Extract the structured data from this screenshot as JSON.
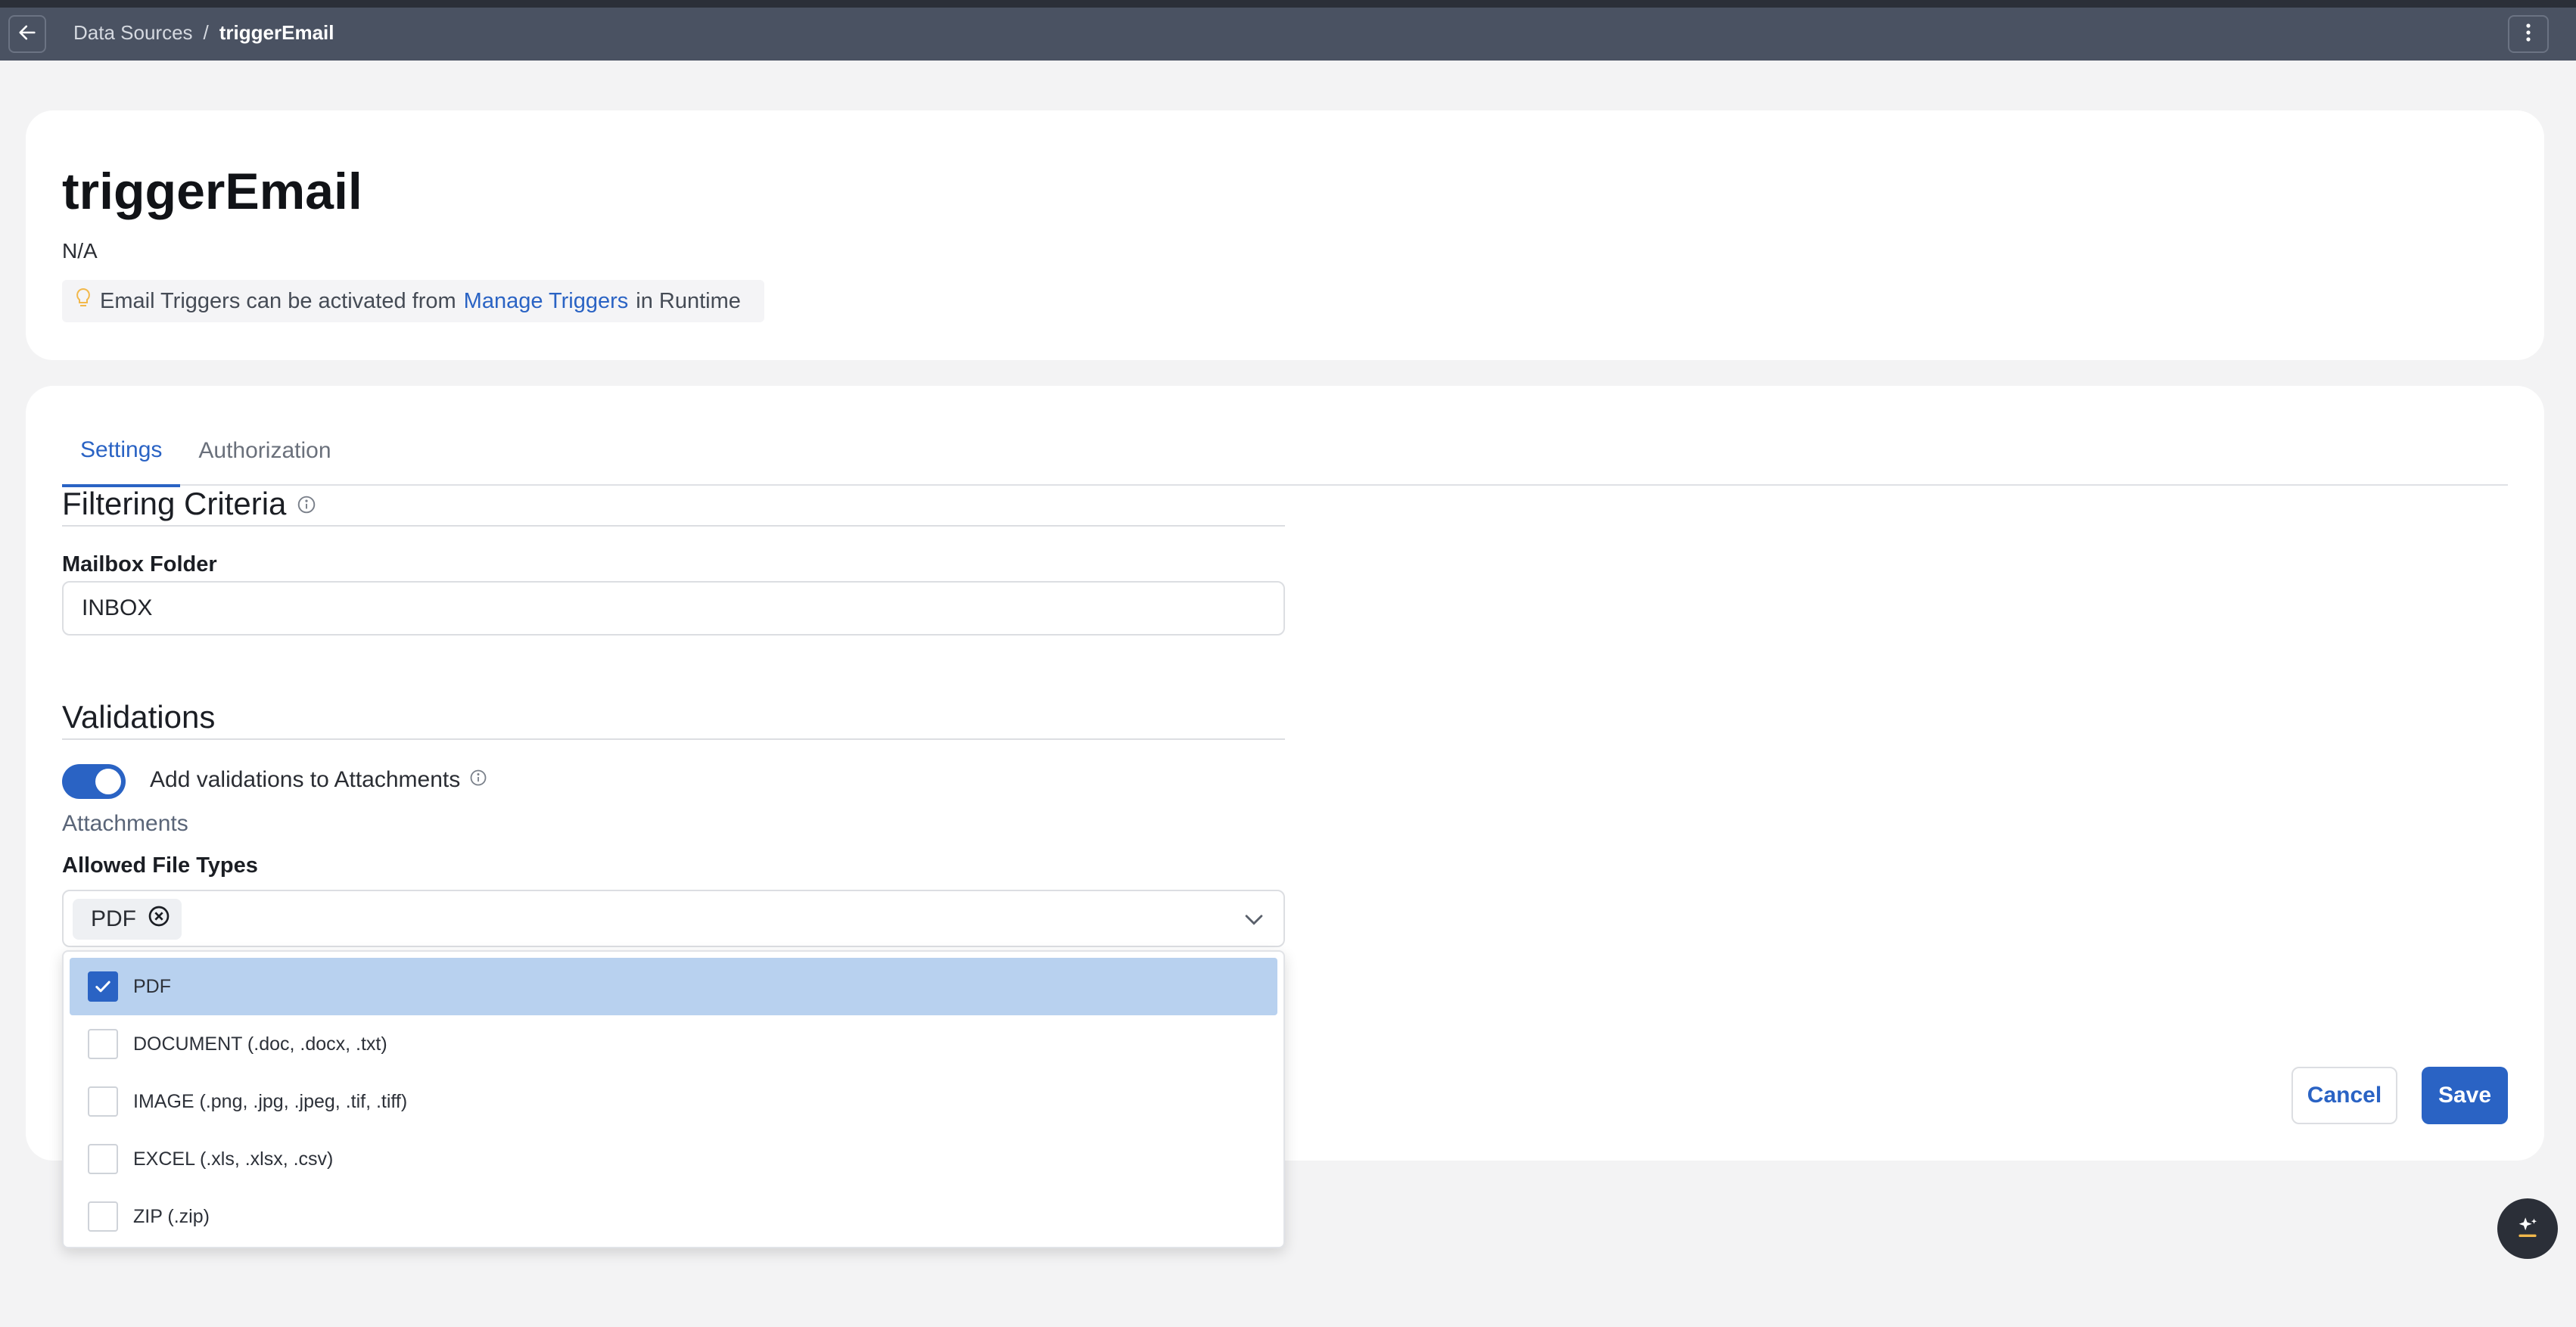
{
  "breadcrumb": {
    "parent": "Data Sources",
    "separator": "/",
    "current": "triggerEmail"
  },
  "header": {
    "title": "triggerEmail",
    "subtitle": "N/A",
    "hint": {
      "prefix": "Email Triggers can be activated from",
      "link": "Manage Triggers",
      "suffix": "in Runtime"
    }
  },
  "tabs": [
    {
      "label": "Settings",
      "active": true
    },
    {
      "label": "Authorization",
      "active": false
    }
  ],
  "filtering": {
    "title": "Filtering Criteria",
    "mailbox_label": "Mailbox Folder",
    "mailbox_value": "INBOX"
  },
  "validations": {
    "title": "Validations",
    "toggle_label": "Add validations to Attachments",
    "toggle_on": true,
    "attachments_label": "Attachments",
    "file_types_label": "Allowed File Types",
    "selected_chip": "PDF",
    "options": [
      {
        "label": "PDF",
        "checked": true
      },
      {
        "label": "DOCUMENT (.doc, .docx, .txt)",
        "checked": false
      },
      {
        "label": "IMAGE (.png, .jpg, .jpeg, .tif, .tiff)",
        "checked": false
      },
      {
        "label": "EXCEL (.xls, .xlsx, .csv)",
        "checked": false
      },
      {
        "label": "ZIP (.zip)",
        "checked": false
      }
    ]
  },
  "actions": {
    "cancel": "Cancel",
    "save": "Save"
  },
  "colors": {
    "accent": "#2a63c4",
    "topbar": "#4a5262",
    "selected_row": "#b8d1ef"
  },
  "icons": {
    "back": "arrow-left-icon",
    "menu": "kebab-icon",
    "hint": "lightbulb-icon",
    "info": "info-icon",
    "chip_remove": "close-circle-icon",
    "chevron": "chevron-down-icon",
    "fab": "sparkle-icon"
  }
}
